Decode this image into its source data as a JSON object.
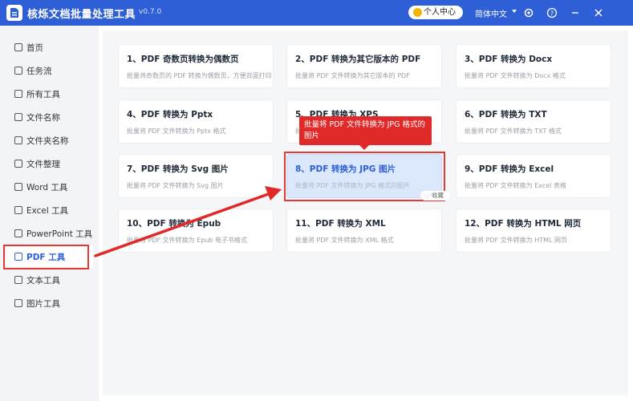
{
  "app": {
    "title": "核烁文档批量处理工具",
    "version": "v0.7.0",
    "user_center": "个人中心",
    "language": "简体中文",
    "icons": [
      "settings-icon",
      "help-icon",
      "minimize-icon",
      "close-icon"
    ],
    "accent_color": "#2f5fd6"
  },
  "sidebar": {
    "items": [
      {
        "label": "首页",
        "icon": "home-icon"
      },
      {
        "label": "任务流",
        "icon": "workflow-icon"
      },
      {
        "label": "所有工具",
        "icon": "monitor-icon"
      },
      {
        "label": "文件名称",
        "icon": "file-name-icon"
      },
      {
        "label": "文件夹名称",
        "icon": "folder-icon"
      },
      {
        "label": "文件整理",
        "icon": "organize-icon"
      },
      {
        "label": "Word 工具",
        "icon": "word-icon"
      },
      {
        "label": "Excel 工具",
        "icon": "excel-icon"
      },
      {
        "label": "PowerPoint 工具",
        "icon": "powerpoint-icon"
      },
      {
        "label": "PDF 工具",
        "icon": "pdf-icon",
        "active": true
      },
      {
        "label": "文本工具",
        "icon": "text-icon"
      },
      {
        "label": "图片工具",
        "icon": "image-icon"
      }
    ]
  },
  "tools": [
    {
      "title": "1、PDF 奇数页转换为偶数页",
      "desc": "批量将奇数页的 PDF 转换为偶数页，方便双面打印"
    },
    {
      "title": "2、PDF 转换为其它版本的 PDF",
      "desc": "批量将 PDF 文件转换为其它版本的 PDF"
    },
    {
      "title": "3、PDF 转换为 Docx",
      "desc": "批量将 PDF 文件转换为 Docx 格式"
    },
    {
      "title": "4、PDF 转换为 Pptx",
      "desc": "批量将 PDF 文件转换为 Pptx 格式"
    },
    {
      "title": "5、PDF 转换为 XPS",
      "desc": "批量将 PDF 文件转换为 XPS 格式"
    },
    {
      "title": "6、PDF 转换为 TXT",
      "desc": "批量将 PDF 文件转换为 TXT 格式"
    },
    {
      "title": "7、PDF 转换为 Svg 图片",
      "desc": "批量将 PDF 文件转换为 Svg 图片"
    },
    {
      "title": "8、PDF 转换为 JPG 图片",
      "desc": "批量将 PDF 文件转换为 JPG 格式的图片",
      "selected": true
    },
    {
      "title": "9、PDF 转换为 Excel",
      "desc": "批量将 PDF 文件转换为 Excel 表格"
    },
    {
      "title": "10、PDF 转换为 Epub",
      "desc": "批量将 PDF 文件转换为 Epub 电子书格式"
    },
    {
      "title": "11、PDF 转换为 XML",
      "desc": "批量将 PDF 文件转换为 XML 格式"
    },
    {
      "title": "12、PDF 转换为 HTML 网页",
      "desc": "批量将 PDF 文件转换为 HTML 网页"
    }
  ],
  "tooltip": {
    "text": "批量将 PDF 文件转换为 JPG 格式的图片"
  },
  "favorite": {
    "label": "收藏"
  },
  "annotation_color": "#e53935"
}
